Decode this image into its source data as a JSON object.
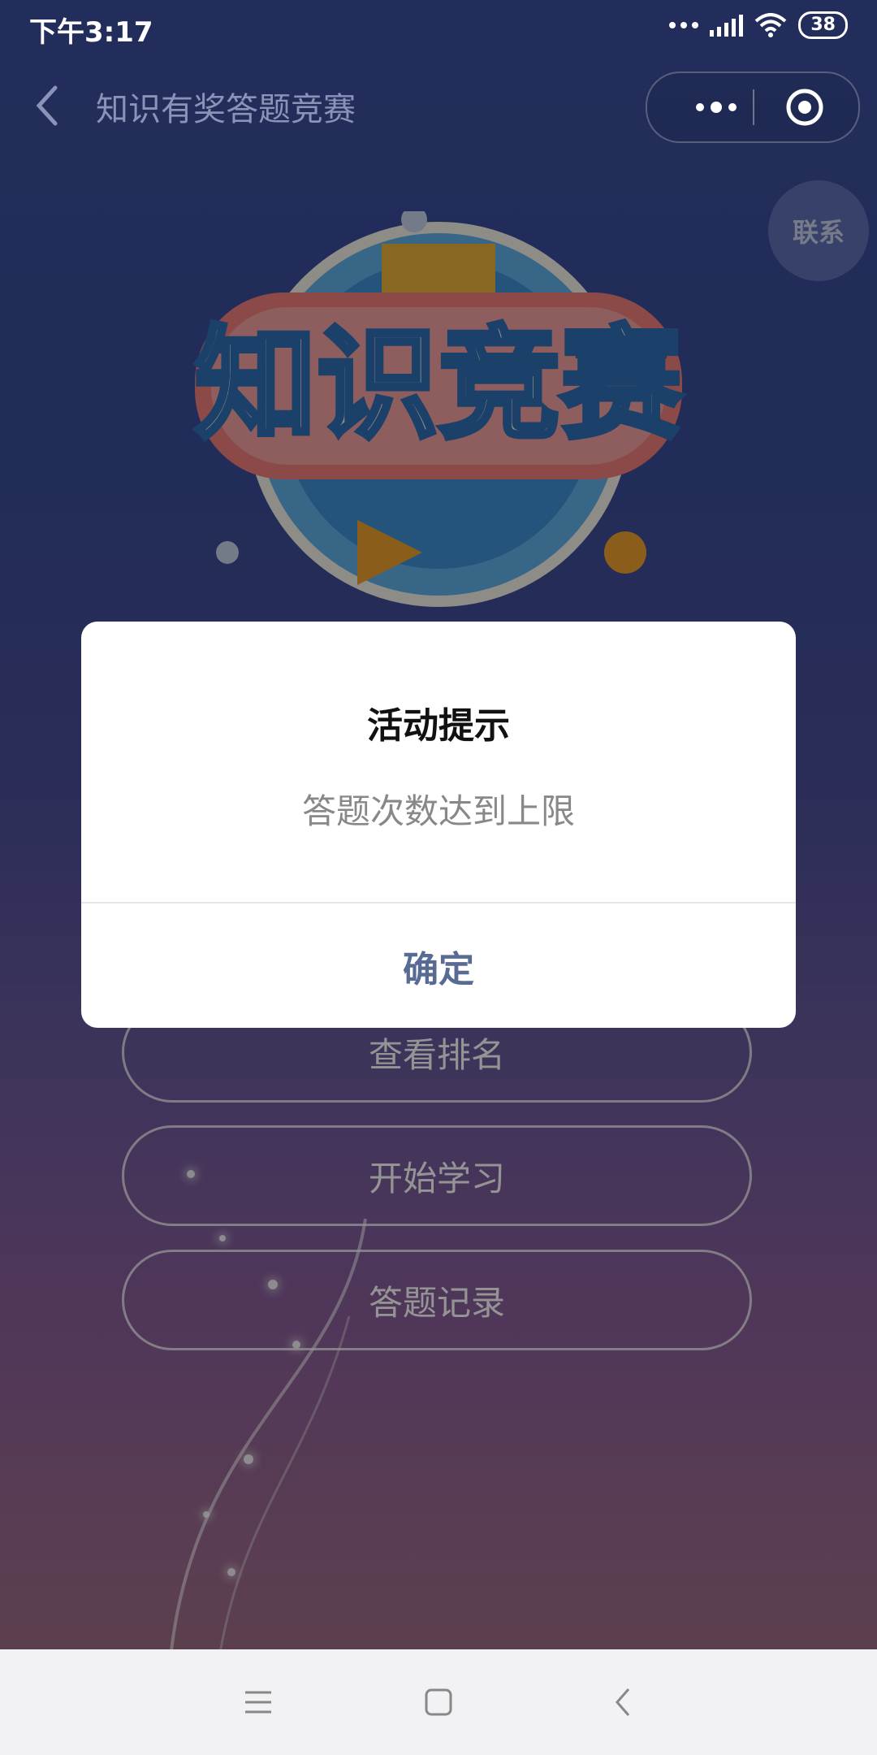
{
  "status_bar": {
    "time": "下午3:17",
    "battery": "38",
    "icons": [
      "more-dots-icon",
      "signal-icon",
      "wifi-icon",
      "battery-icon"
    ]
  },
  "header": {
    "title": "知识有奖答题竞赛",
    "back_icon": "chevron-left-icon",
    "menu_icon": "more-dots-icon",
    "close_icon": "target-circle-icon"
  },
  "contact": {
    "label": "联系"
  },
  "banner": {
    "text": "知识竞赛"
  },
  "actions": [
    {
      "label": "查看排名"
    },
    {
      "label": "开始学习"
    },
    {
      "label": "答题记录"
    }
  ],
  "dialog": {
    "title": "活动提示",
    "message": "答题次数达到上限",
    "confirm_label": "确定"
  },
  "navbar": {
    "icons": [
      "menu-lines-icon",
      "home-square-icon",
      "back-chevron-icon"
    ]
  },
  "colors": {
    "dialog_button": "#576b95",
    "background_top": "#3b4f9e",
    "background_bottom": "#a3707e"
  }
}
